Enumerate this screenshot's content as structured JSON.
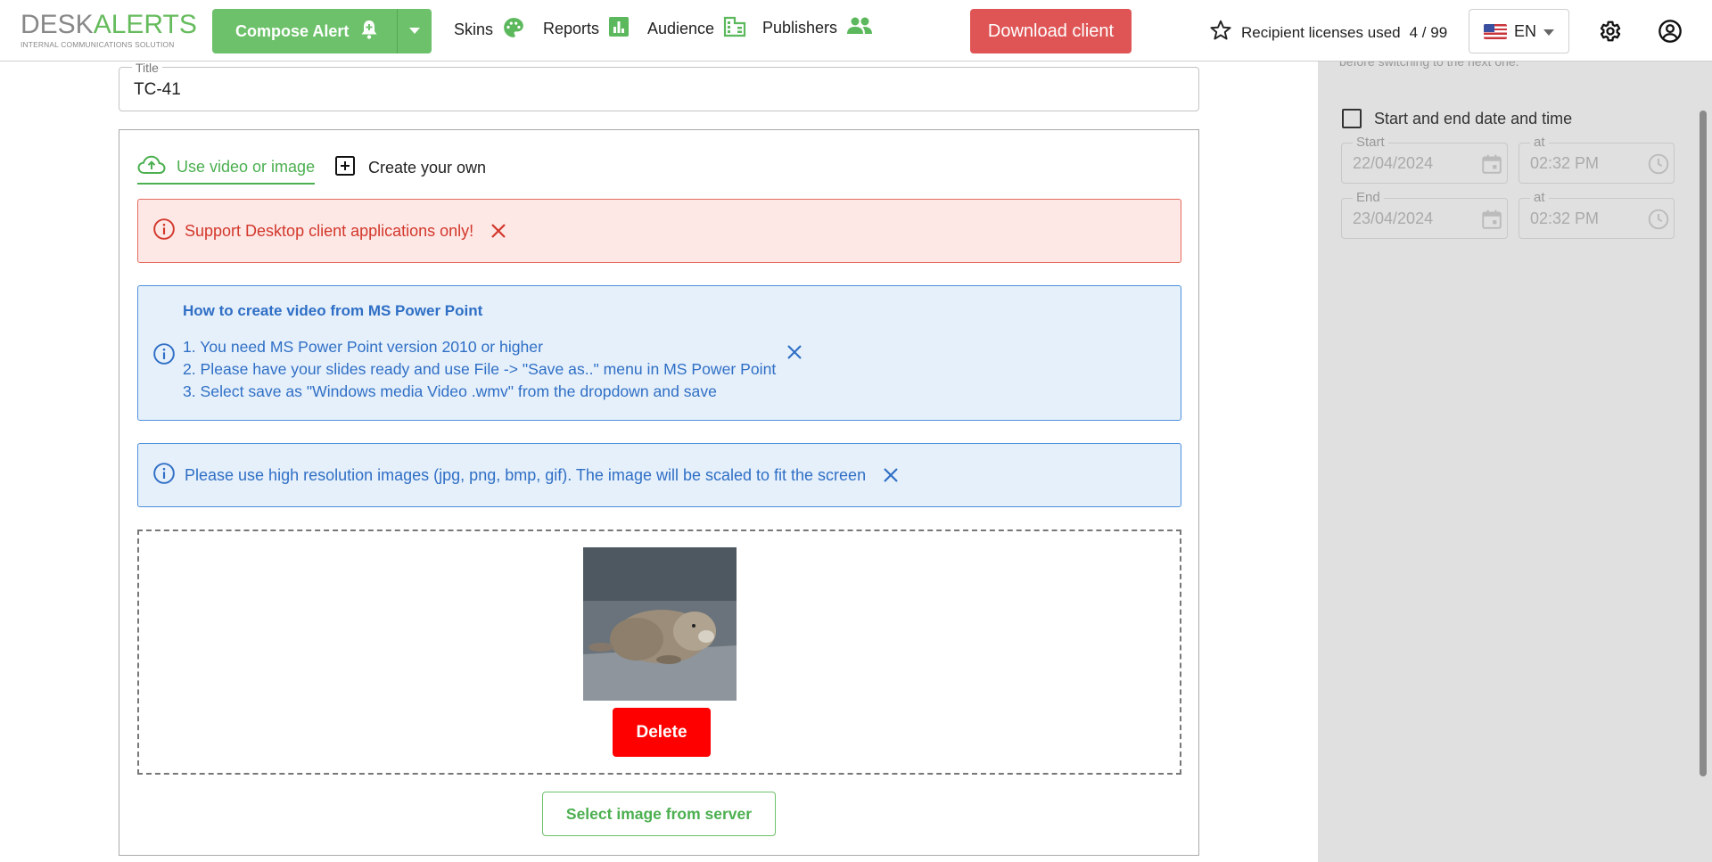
{
  "brand": {
    "logo_part1": "DESK",
    "logo_part2": "ALERTS",
    "logo_tagline": "INTERNAL COMMUNICATIONS SOLUTION",
    "accent": "#6cc16a",
    "logo_gray": "#888888"
  },
  "nav": {
    "compose_label": "Compose Alert",
    "skins": "Skins",
    "reports": "Reports",
    "audience": "Audience",
    "publishers": "Publishers",
    "download": "Download client",
    "licenses_label": "Recipient licenses used",
    "licenses_value": "4 / 99",
    "language": "EN"
  },
  "form": {
    "title_legend": "Title",
    "title_value": "TC-41"
  },
  "tabs": {
    "use_media": "Use video or image",
    "create_own": "Create your own"
  },
  "alerts": {
    "desktop_only": "Support Desktop client applications only!",
    "howto_title": "How to create video from MS Power Point",
    "howto_steps": [
      "1. You need MS Power Point version 2010 or higher",
      "2. Please have your slides ready and use File -> \"Save as..\" menu in MS Power Point",
      "3. Select save as \"Windows media Video .wmv\" from the dropdown and save"
    ],
    "hires": "Please use high resolution images (jpg, png, bmp, gif). The image will be scaled to fit the screen"
  },
  "upload": {
    "delete_label": "Delete",
    "select_server": "Select image from server"
  },
  "side": {
    "cut_text": "before switching to the next one.",
    "dt_label": "Start and end date and time",
    "start_label": "Start",
    "start_date": "22/04/2024",
    "at_label": "at",
    "start_time": "02:32 PM",
    "end_label": "End",
    "end_date": "23/04/2024",
    "end_time": "02:32 PM"
  },
  "colors": {
    "red_alert": "#d3372b",
    "blue_alert": "#2f6fc5",
    "download_bg": "#df5555",
    "delete_bg": "#ff0000",
    "side_bg": "#e0e0e0"
  }
}
